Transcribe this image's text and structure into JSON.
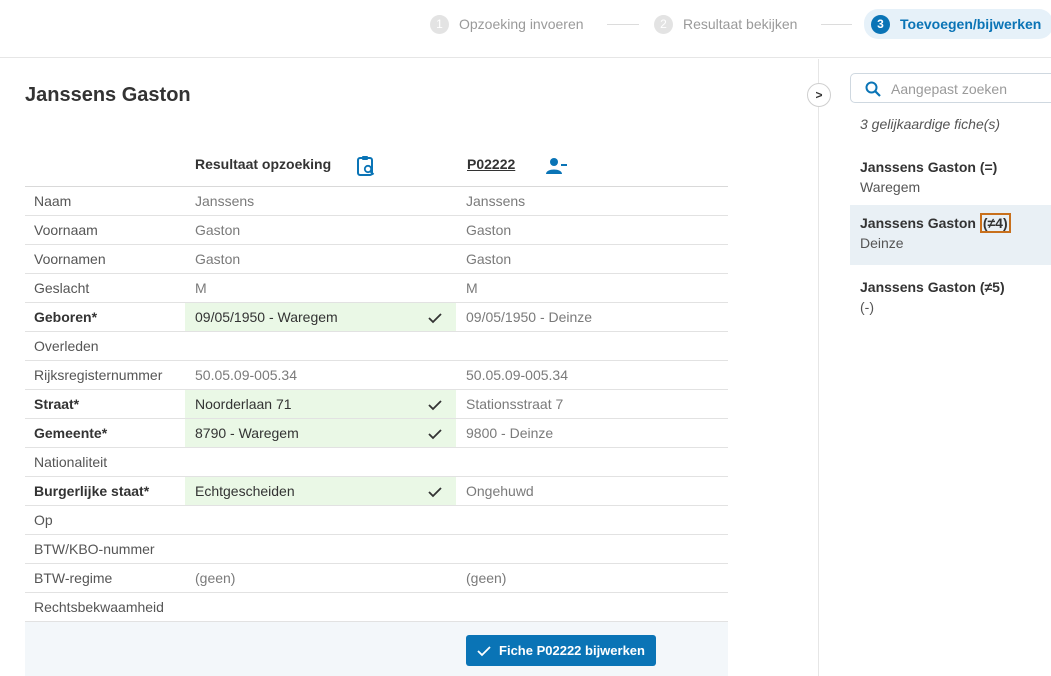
{
  "stepper": {
    "steps": [
      {
        "num": "1",
        "label": "Opzoeking invoeren"
      },
      {
        "num": "2",
        "label": "Resultaat bekijken"
      },
      {
        "num": "3",
        "label": "Toevoegen/bijwerken"
      }
    ]
  },
  "main": {
    "title": "Janssens Gaston",
    "col_result": "Resultaat opzoeking",
    "col_record": "P02222",
    "rows": [
      {
        "label": "Naam",
        "v1": "Janssens",
        "v2": "Janssens"
      },
      {
        "label": "Voornaam",
        "v1": "Gaston",
        "v2": "Gaston"
      },
      {
        "label": "Voornamen",
        "v1": "Gaston",
        "v2": "Gaston"
      },
      {
        "label": "Geslacht",
        "v1": "M",
        "v2": "M"
      },
      {
        "label": "Geboren*",
        "v1": "09/05/1950 - Waregem",
        "v2": "09/05/1950 - Deinze"
      },
      {
        "label": "Overleden",
        "v1": "",
        "v2": ""
      },
      {
        "label": "Rijksregisternummer",
        "v1": "50.05.09-005.34",
        "v2": "50.05.09-005.34"
      },
      {
        "label": "Straat*",
        "v1": "Noorderlaan 71",
        "v2": "Stationsstraat 7"
      },
      {
        "label": "Gemeente*",
        "v1": "8790 - Waregem",
        "v2": "9800 - Deinze"
      },
      {
        "label": "Nationaliteit",
        "v1": "",
        "v2": ""
      },
      {
        "label": "Burgerlijke staat*",
        "v1": "Echtgescheiden",
        "v2": "Ongehuwd"
      },
      {
        "label": "Op",
        "v1": "",
        "v2": ""
      },
      {
        "label": "BTW/KBO-nummer",
        "v1": "",
        "v2": ""
      },
      {
        "label": "BTW-regime",
        "v1": "(geen)",
        "v2": "(geen)"
      },
      {
        "label": "Rechtsbekwaamheid",
        "v1": "",
        "v2": ""
      }
    ],
    "update_button": "Fiche P02222 bijwerken",
    "collapse_label": ">"
  },
  "sidebar": {
    "search_placeholder": "Aangepast zoeken",
    "count": "3 gelijkaardige fiche(s)",
    "fiches": [
      {
        "name": "Janssens Gaston",
        "tag": "(=)",
        "location": "Waregem"
      },
      {
        "name": "Janssens Gaston",
        "tag": "(≠4)",
        "location": "Deinze"
      },
      {
        "name": "Janssens Gaston",
        "tag": "(≠5)",
        "location": "(-)"
      }
    ]
  },
  "colors": {
    "accent": "#0a74b6",
    "selected_bg": "#eaf8e6",
    "highlight_border": "#c8701c"
  },
  "icons": {
    "clipboard": "clipboard-search-icon",
    "person": "person-remove-icon",
    "check": "check-icon",
    "search": "search-icon"
  }
}
